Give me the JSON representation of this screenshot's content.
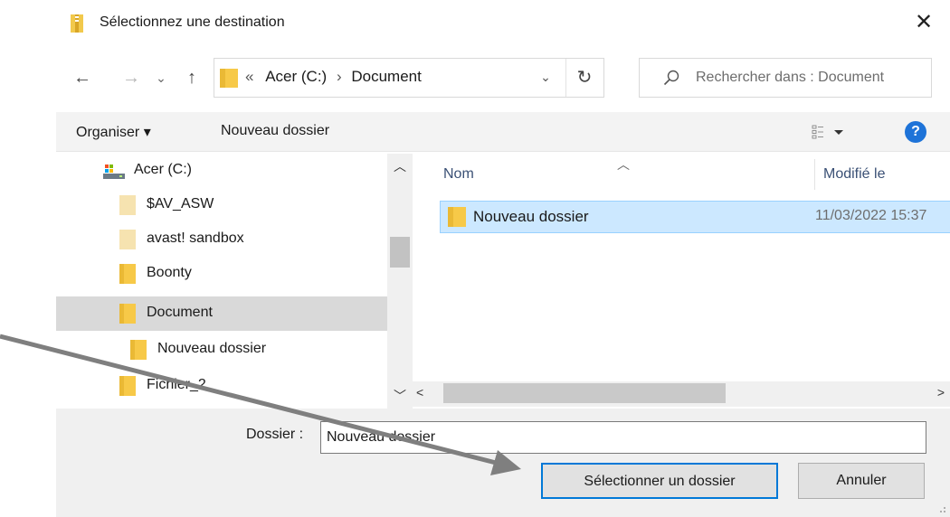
{
  "window": {
    "title": "Sélectionnez une destination",
    "close_glyph": "✕"
  },
  "nav": {
    "back_glyph": "←",
    "forward_glyph": "→",
    "recent_glyph": "⌄",
    "up_glyph": "↑",
    "address": {
      "prefix": "«",
      "segments": [
        "Acer (C:)",
        "Document"
      ],
      "separator": "›",
      "dropdown_glyph": "⌄"
    },
    "refresh_glyph": "↻",
    "search_placeholder": "Rechercher dans : Document"
  },
  "toolbar": {
    "organize_label": "Organiser ▾",
    "new_folder_label": "Nouveau dossier",
    "help_label": "?"
  },
  "tree": {
    "items": [
      {
        "label": "Acer (C:)",
        "icon": "drive-icon",
        "selected": false
      },
      {
        "label": "$AV_ASW",
        "icon": "folder-pale-icon",
        "selected": false
      },
      {
        "label": "avast! sandbox",
        "icon": "folder-pale-icon",
        "selected": false
      },
      {
        "label": "Boonty",
        "icon": "folder-icon",
        "selected": false
      },
      {
        "label": "Document",
        "icon": "folder-icon",
        "selected": true
      },
      {
        "label": "Nouveau dossier",
        "icon": "folder-icon",
        "selected": false
      },
      {
        "label": "Fichier_2",
        "icon": "folder-icon",
        "selected": false
      }
    ]
  },
  "list": {
    "columns": [
      "Nom",
      "Modifié le"
    ],
    "rows": [
      {
        "name": "Nouveau dossier",
        "modified": "11/03/2022 15:37"
      }
    ]
  },
  "footer": {
    "folder_label": "Dossier :",
    "folder_value": "Nouveau dossier",
    "select_button": "Sélectionner un dossier",
    "cancel_button": "Annuler"
  },
  "colors": {
    "folder": "#f7c948",
    "folder_pale": "#f6e3b0",
    "selection": "#cce8ff",
    "accent": "#0078d7",
    "arrow": "#7f7f7f"
  }
}
